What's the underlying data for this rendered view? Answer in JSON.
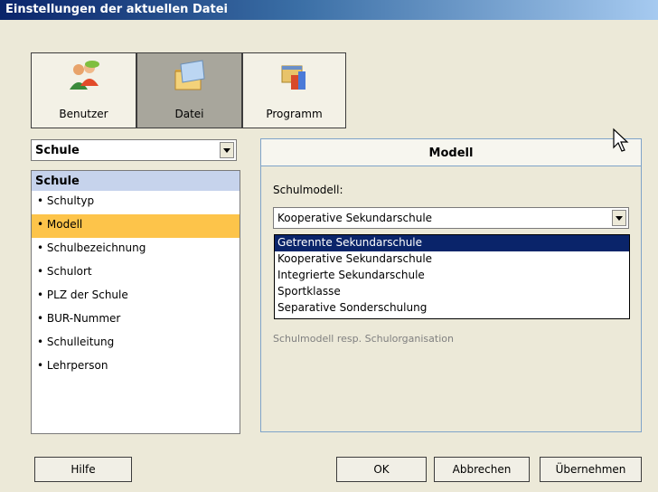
{
  "window": {
    "title": "Einstellungen der aktuellen Datei"
  },
  "toolbar": {
    "buttons": [
      {
        "label": "Benutzer",
        "icon": "users-icon",
        "active": false
      },
      {
        "label": "Datei",
        "icon": "folder-icon",
        "active": true
      },
      {
        "label": "Programm",
        "icon": "program-icon",
        "active": false
      }
    ]
  },
  "category_select": {
    "value": "Schule"
  },
  "left_list": {
    "header": "Schule",
    "items": [
      {
        "label": "• Schultyp",
        "selected": false
      },
      {
        "label": "• Modell",
        "selected": true
      },
      {
        "label": "• Schulbezeichnung",
        "selected": false
      },
      {
        "label": "• Schulort",
        "selected": false
      },
      {
        "label": "• PLZ der Schule",
        "selected": false
      },
      {
        "label": "• BUR-Nummer",
        "selected": false
      },
      {
        "label": "• Schulleitung",
        "selected": false
      },
      {
        "label": "• Lehrperson",
        "selected": false
      }
    ]
  },
  "panel": {
    "title": "Modell",
    "field_label": "Schulmodell:",
    "select_value": "Kooperative Sekundarschule",
    "options": [
      {
        "label": "Getrennte Sekundarschule",
        "highlighted": true
      },
      {
        "label": "Kooperative Sekundarschule",
        "highlighted": false
      },
      {
        "label": "Integrierte Sekundarschule",
        "highlighted": false
      },
      {
        "label": "Sportklasse",
        "highlighted": false
      },
      {
        "label": "Separative Sonderschulung",
        "highlighted": false
      }
    ],
    "hint": "Schulmodell resp. Schulorganisation"
  },
  "buttons": {
    "help": "Hilfe",
    "ok": "OK",
    "cancel": "Abbrechen",
    "apply": "Übernehmen"
  },
  "colors": {
    "selection": "#fdc44a",
    "list_header": "#c6d3ec",
    "option_highlight": "#0a246a",
    "panel_border": "#7fa3c9"
  }
}
